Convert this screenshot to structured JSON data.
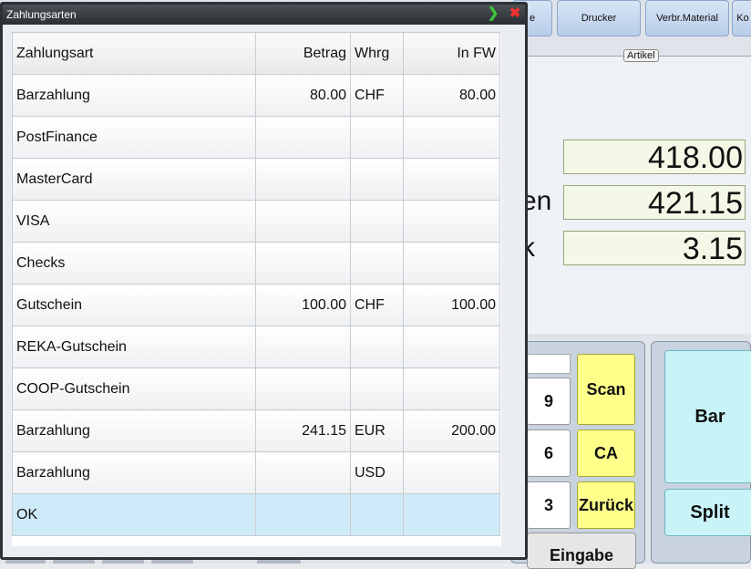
{
  "window": {
    "title": "Zahlungsarten"
  },
  "background": {
    "category_buttons": [
      "e",
      "Drucker",
      "Verbr.Material",
      "Ko"
    ],
    "group_label": "Artikel",
    "totals": [
      {
        "label_fragment": "",
        "value": "418.00"
      },
      {
        "label_fragment": "en",
        "value": "421.15"
      },
      {
        "label_fragment": "k",
        "value": "3.15"
      }
    ],
    "keypad": {
      "keys": [
        "9",
        "6",
        "3"
      ],
      "scan": "Scan",
      "ca": "CA",
      "back": "Zurück",
      "enter": "Eingabe"
    },
    "pay_buttons": {
      "bar": "Bar",
      "split": "Split"
    }
  },
  "table": {
    "columns": [
      "Zahlungsart",
      "Betrag",
      "Whrg",
      "In FW"
    ],
    "rows": [
      {
        "name": "Barzahlung",
        "amount": "80.00",
        "currency": "CHF",
        "fw": "80.00"
      },
      {
        "name": "PostFinance",
        "amount": "",
        "currency": "",
        "fw": ""
      },
      {
        "name": "MasterCard",
        "amount": "",
        "currency": "",
        "fw": ""
      },
      {
        "name": "VISA",
        "amount": "",
        "currency": "",
        "fw": ""
      },
      {
        "name": "Checks",
        "amount": "",
        "currency": "",
        "fw": ""
      },
      {
        "name": "Gutschein",
        "amount": "100.00",
        "currency": "CHF",
        "fw": "100.00"
      },
      {
        "name": "REKA-Gutschein",
        "amount": "",
        "currency": "",
        "fw": ""
      },
      {
        "name": "COOP-Gutschein",
        "amount": "",
        "currency": "",
        "fw": ""
      },
      {
        "name": "Barzahlung",
        "amount": "241.15",
        "currency": "EUR",
        "fw": "200.00"
      },
      {
        "name": "Barzahlung",
        "amount": "",
        "currency": "USD",
        "fw": ""
      },
      {
        "name": "OK",
        "amount": "",
        "currency": "",
        "fw": ""
      }
    ],
    "selected_index": 10
  },
  "colors": {
    "selected_row": "#cfeaf8",
    "scan_button": "#ffff8a",
    "pay_button": "#c8f4f8"
  }
}
